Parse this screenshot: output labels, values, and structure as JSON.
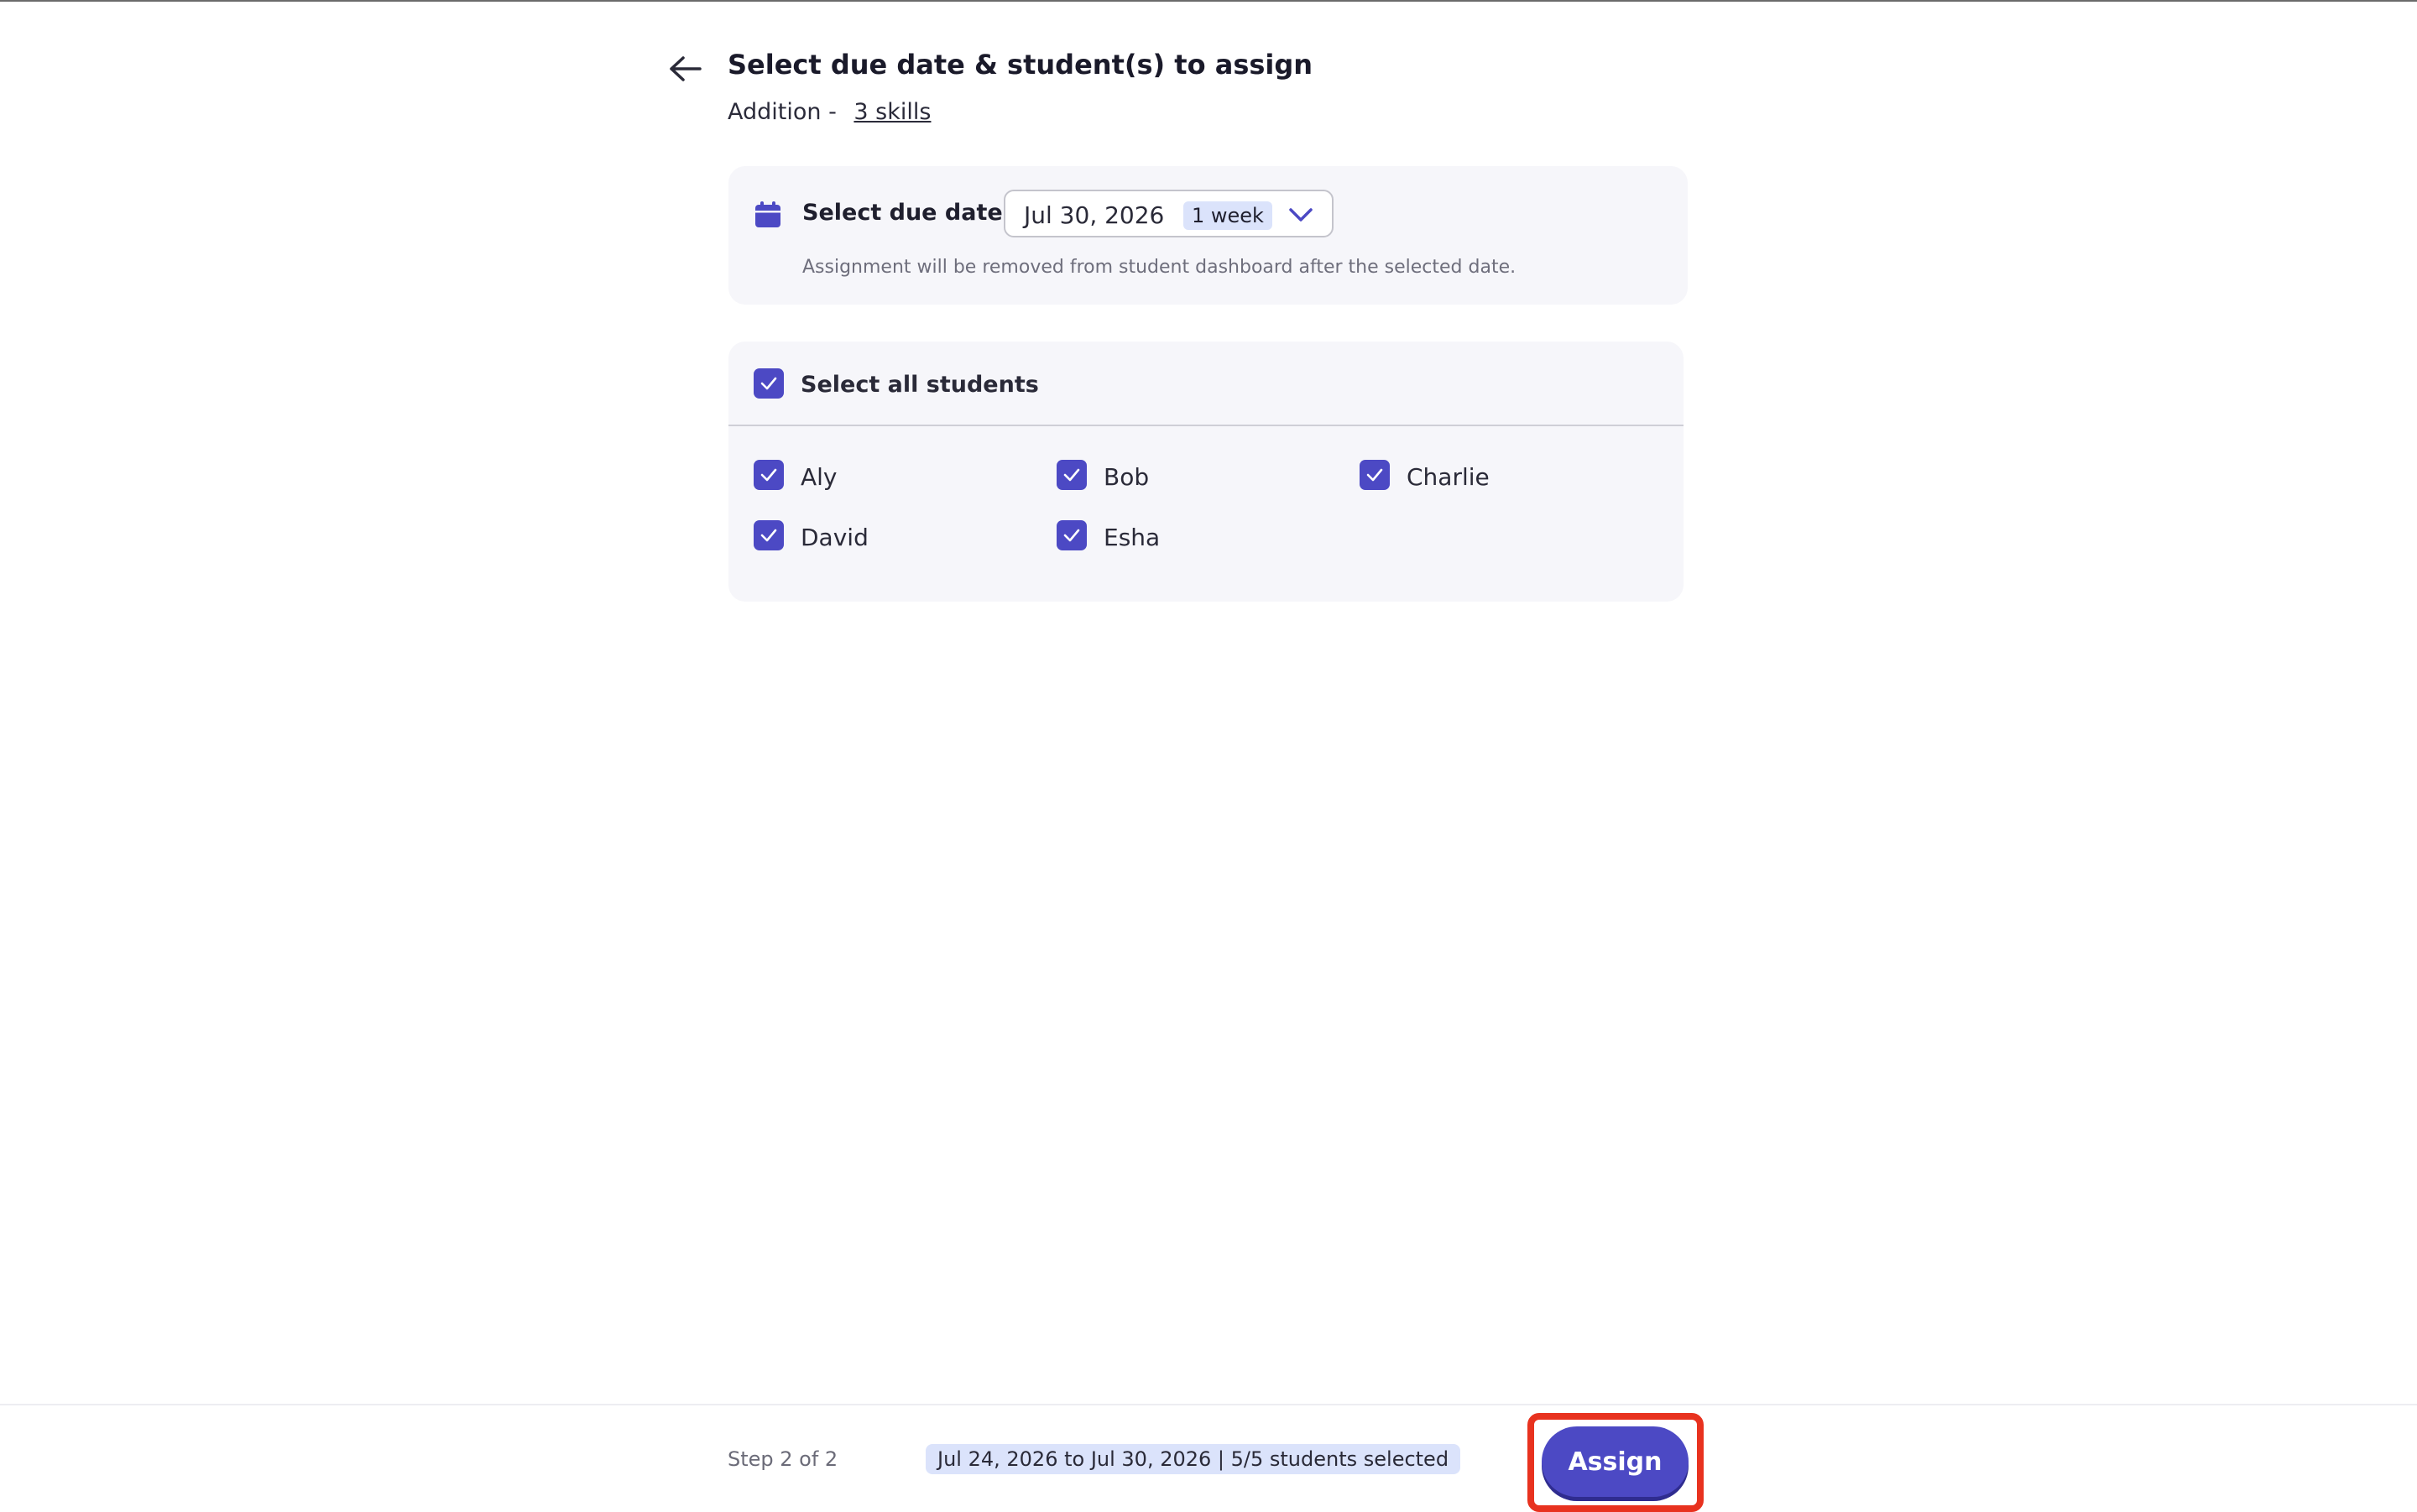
{
  "header": {
    "title": "Select due date & student(s) to assign",
    "subtitle_prefix": "Addition -",
    "skills_link": "3 skills"
  },
  "due_date": {
    "label": "Select due date:",
    "selected_date": "Jul 30, 2026",
    "duration_badge": "1 week",
    "note": "Assignment will be removed from student dashboard after the selected date."
  },
  "students": {
    "select_all_label": "Select all students",
    "select_all_checked": true,
    "list": [
      {
        "name": "Aly",
        "checked": true
      },
      {
        "name": "Bob",
        "checked": true
      },
      {
        "name": "Charlie",
        "checked": true
      },
      {
        "name": "David",
        "checked": true
      },
      {
        "name": "Esha",
        "checked": true
      }
    ]
  },
  "footer": {
    "step": "Step 2 of 2",
    "summary": "Jul 24, 2026 to Jul 30, 2026 | 5/5 students selected",
    "assign_label": "Assign"
  },
  "colors": {
    "accent": "#4c49c4",
    "highlight": "#e8321f",
    "badge_bg": "#dbe3fb",
    "card_bg": "#f6f6fa"
  },
  "icons": {
    "back": "arrow-left-icon",
    "calendar": "calendar-icon",
    "dropdown": "chevron-down-icon",
    "check": "checkmark-icon"
  }
}
